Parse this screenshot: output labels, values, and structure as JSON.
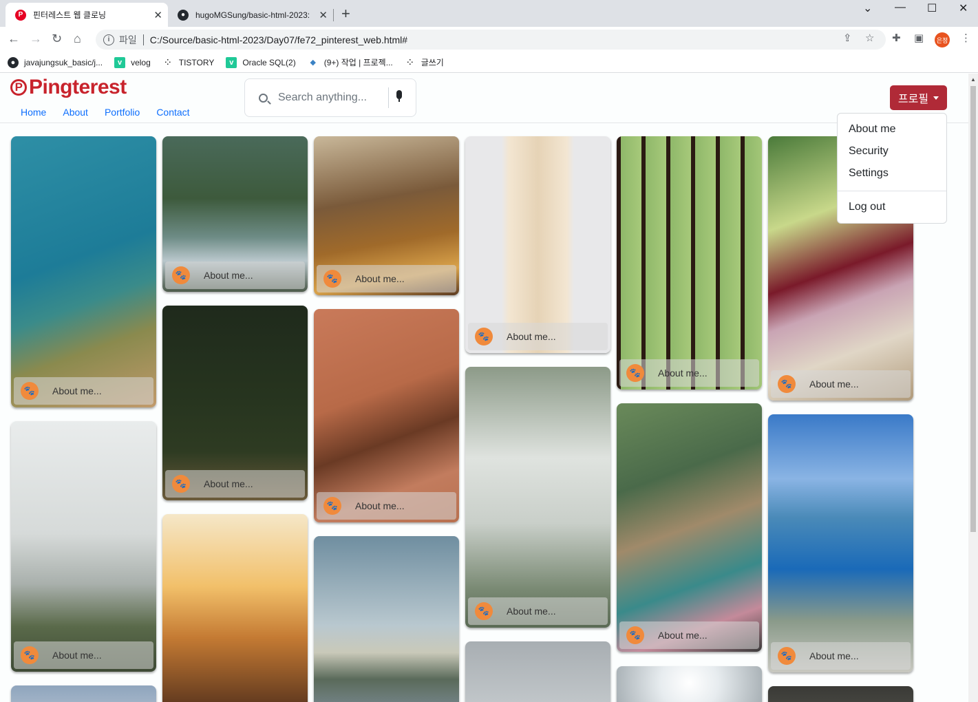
{
  "browser": {
    "tabs": [
      {
        "title": "핀터레스트 웹 클로닝",
        "icon": "pinterest-icon",
        "active": true
      },
      {
        "title": "hugoMGSung/basic-html-2023:",
        "icon": "github-icon",
        "active": false
      }
    ],
    "url_scheme": "파일",
    "url": "C:/Source/basic-html-2023/Day07/fe72_pinterest_web.html#",
    "profile_initials": "은정",
    "bookmarks": [
      {
        "label": "javajungsuk_basic/j...",
        "icon": "github-icon"
      },
      {
        "label": "velog",
        "icon": "velog-icon"
      },
      {
        "label": "TISTORY",
        "icon": "tistory-icon"
      },
      {
        "label": "Oracle SQL(2)",
        "icon": "velog-icon"
      },
      {
        "label": "(9+) 작업 | 프로젝...",
        "icon": "whale-icon"
      },
      {
        "label": "글쓰기",
        "icon": "tistory-icon"
      }
    ]
  },
  "site": {
    "logo_text": "Pingterest",
    "brand_color": "#c8232c",
    "nav": [
      "Home",
      "About",
      "Portfolio",
      "Contact"
    ],
    "search_placeholder": "Search anything...",
    "profile_button": "프로필",
    "dropdown": [
      "About me",
      "Security",
      "Settings",
      "Log out"
    ]
  },
  "cards": {
    "caption": "About me...",
    "columns": [
      [
        {
          "image": "coastal-cliff-ocean",
          "caption_visible": true
        },
        {
          "image": "misty-mountain-cliff",
          "caption_visible": true
        },
        {
          "image": "cloudy-sky",
          "caption_visible": false
        }
      ],
      [
        {
          "image": "forest-stream",
          "caption_visible": true
        },
        {
          "image": "night-sky-fence",
          "caption_visible": true
        },
        {
          "image": "sunset-city-traffic",
          "caption_visible": false
        }
      ],
      [
        {
          "image": "autumn-leaves-forest",
          "caption_visible": true
        },
        {
          "image": "camera-tea-table",
          "caption_visible": true
        },
        {
          "image": "lake-horizon",
          "caption_visible": false
        }
      ],
      [
        {
          "image": "white-staircase",
          "caption_visible": true
        },
        {
          "image": "foggy-forest-hiker",
          "caption_visible": true
        },
        {
          "image": "misty-grey",
          "caption_visible": false
        }
      ],
      [
        {
          "image": "window-greenery",
          "caption_visible": true
        },
        {
          "image": "floating-market",
          "caption_visible": true
        },
        {
          "image": "bright-sun-clouds",
          "caption_visible": false
        }
      ],
      [
        {
          "image": "red-onion-peppercorns",
          "caption_visible": true
        },
        {
          "image": "fjord-cliff",
          "caption_visible": true
        },
        {
          "image": "dark-photo",
          "caption_visible": false
        }
      ]
    ]
  }
}
